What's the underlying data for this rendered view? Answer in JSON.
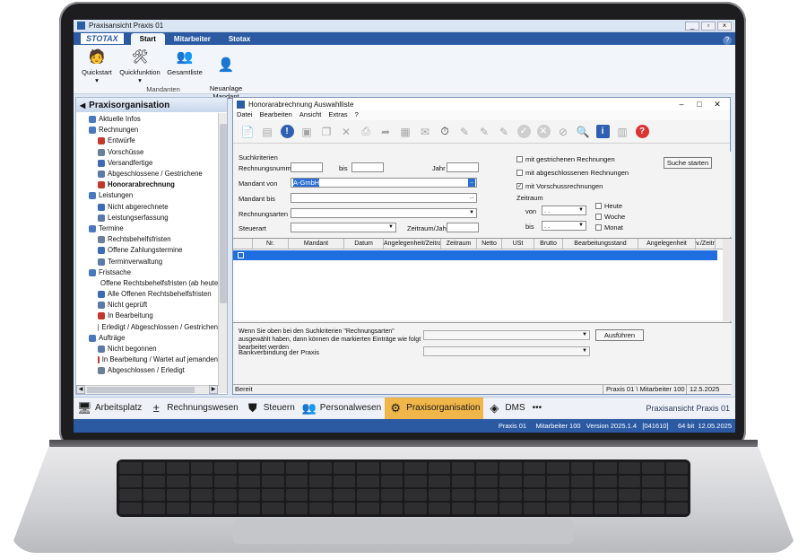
{
  "window": {
    "title": "Praxisansicht Praxis 01"
  },
  "ribbon": {
    "logo": "STOTAX",
    "tabs": [
      "Start",
      "Mitarbeiter",
      "Stotax"
    ],
    "buttons": [
      {
        "label": "Quickstart",
        "icon": "person-run-icon"
      },
      {
        "label": "Quickfunktion",
        "icon": "tools-icon"
      },
      {
        "label": "Gesamtliste",
        "icon": "people-icon"
      },
      {
        "label": "Neuanlage\nMandant",
        "icon": "person-add-icon"
      }
    ],
    "group_label": "Mandanten"
  },
  "sidebar": {
    "title": "Praxisorganisation",
    "items": [
      {
        "label": "Aktuelle Infos",
        "level": 1
      },
      {
        "label": "Rechnungen",
        "level": 1
      },
      {
        "label": "Entwürfe",
        "level": 2
      },
      {
        "label": "Vorschüsse",
        "level": 2
      },
      {
        "label": "Versandfertige",
        "level": 2
      },
      {
        "label": "Abgeschlossene / Gestrichene",
        "level": 2
      },
      {
        "label": "Honorarabrechnung",
        "level": 2,
        "selected": true
      },
      {
        "label": "Leistungen",
        "level": 1
      },
      {
        "label": "Nicht abgerechnete",
        "level": 2
      },
      {
        "label": "Leistungserfassung",
        "level": 2
      },
      {
        "label": "Termine",
        "level": 1
      },
      {
        "label": "Rechtsbehelfsfristen",
        "level": 2
      },
      {
        "label": "Offene Zahlungstermine",
        "level": 2
      },
      {
        "label": "Terminverwaltung",
        "level": 2
      },
      {
        "label": "Fristsache",
        "level": 1
      },
      {
        "label": "Offene Rechtsbehelfsfristen (ab heute)",
        "level": 2
      },
      {
        "label": "Alle Offenen Rechtsbehelfsfristen",
        "level": 2
      },
      {
        "label": "Nicht geprüft",
        "level": 2
      },
      {
        "label": "In Bearbeitung",
        "level": 2
      },
      {
        "label": "Erledigt / Abgeschlossen / Gestrichen",
        "level": 2
      },
      {
        "label": "Aufträge",
        "level": 1
      },
      {
        "label": "Nicht begonnen",
        "level": 2
      },
      {
        "label": "In Bearbeitung / Wartet auf jemanden",
        "level": 2
      },
      {
        "label": "Abgeschlossen / Erledigt",
        "level": 2
      }
    ]
  },
  "child": {
    "title": "Honorarabrechnung Auswahlliste",
    "menu": [
      "Datei",
      "Bearbeiten",
      "Ansicht",
      "Extras",
      "?"
    ],
    "search": {
      "section": "Suchkriterien",
      "rechnungsnummer_label": "Rechnungsnummer",
      "bis_label": "bis",
      "jahr_label": "Jahr",
      "mandant_von_label": "Mandant von",
      "mandant_von_value": "A-GmbH",
      "mandant_bis_label": "Mandant bis",
      "rechnungsarten_label": "Rechnungsarten",
      "steuerart_label": "Steuerart",
      "zeitraum_jahr_label": "Zeitraum/Jahr",
      "ellipsis": "...",
      "checks": [
        {
          "label": "mit gestrichenen Rechnungen",
          "checked": false
        },
        {
          "label": "mit abgeschlossenen Rechnungen",
          "checked": false
        },
        {
          "label": "mit Vorschussrechnungen",
          "checked": true
        }
      ],
      "zeitraum_label": "Zeitraum",
      "von_label": "von",
      "bis2_label": "bis",
      "date_placeholder": ". .",
      "period_checks": [
        "Heute",
        "Woche",
        "Monat"
      ],
      "search_button": "Suche starten"
    },
    "grid": {
      "columns": [
        "",
        "Nr.",
        "Mandant",
        "Datum",
        "Angelegenheit/Zeitraum",
        "Zeitraum",
        "Netto",
        "USt",
        "Brutto",
        "Bearbeitungsstand",
        "Angelegenheit",
        "v./Zeitr"
      ]
    },
    "bottom": {
      "info": "Wenn Sie oben bei den Suchkriterien \"Rechnungsarten\" ausgewählt haben, dann können die markierten Einträge wie folgt bearbeitet werden",
      "bank_label": "Bankverbindung der Praxis",
      "ausfuehren": "Ausführen"
    },
    "status": {
      "left": "Bereit",
      "user": "Praxis 01 \\ Mitarbeiter 100",
      "date": "12.5.2025"
    }
  },
  "nav": {
    "items": [
      {
        "label": "Arbeitsplatz",
        "icon": "monitor-icon"
      },
      {
        "label": "Rechnungswesen",
        "icon": "calculator-icon"
      },
      {
        "label": "Steuern",
        "icon": "tax-shield-icon"
      },
      {
        "label": "Personalwesen",
        "icon": "people-icon"
      },
      {
        "label": "Praxisorganisation",
        "icon": "gear-organisation-icon",
        "active": true
      },
      {
        "label": "DMS",
        "icon": "documents-icon"
      },
      {
        "label": "•••",
        "icon": "more-icon"
      }
    ],
    "right": "Praxisansicht Praxis 01"
  },
  "statusbar": {
    "text": "Praxis 01     Mitarbeiter 100   Version 2025.1.4   [041610]     64 bit  12.05.2025"
  }
}
